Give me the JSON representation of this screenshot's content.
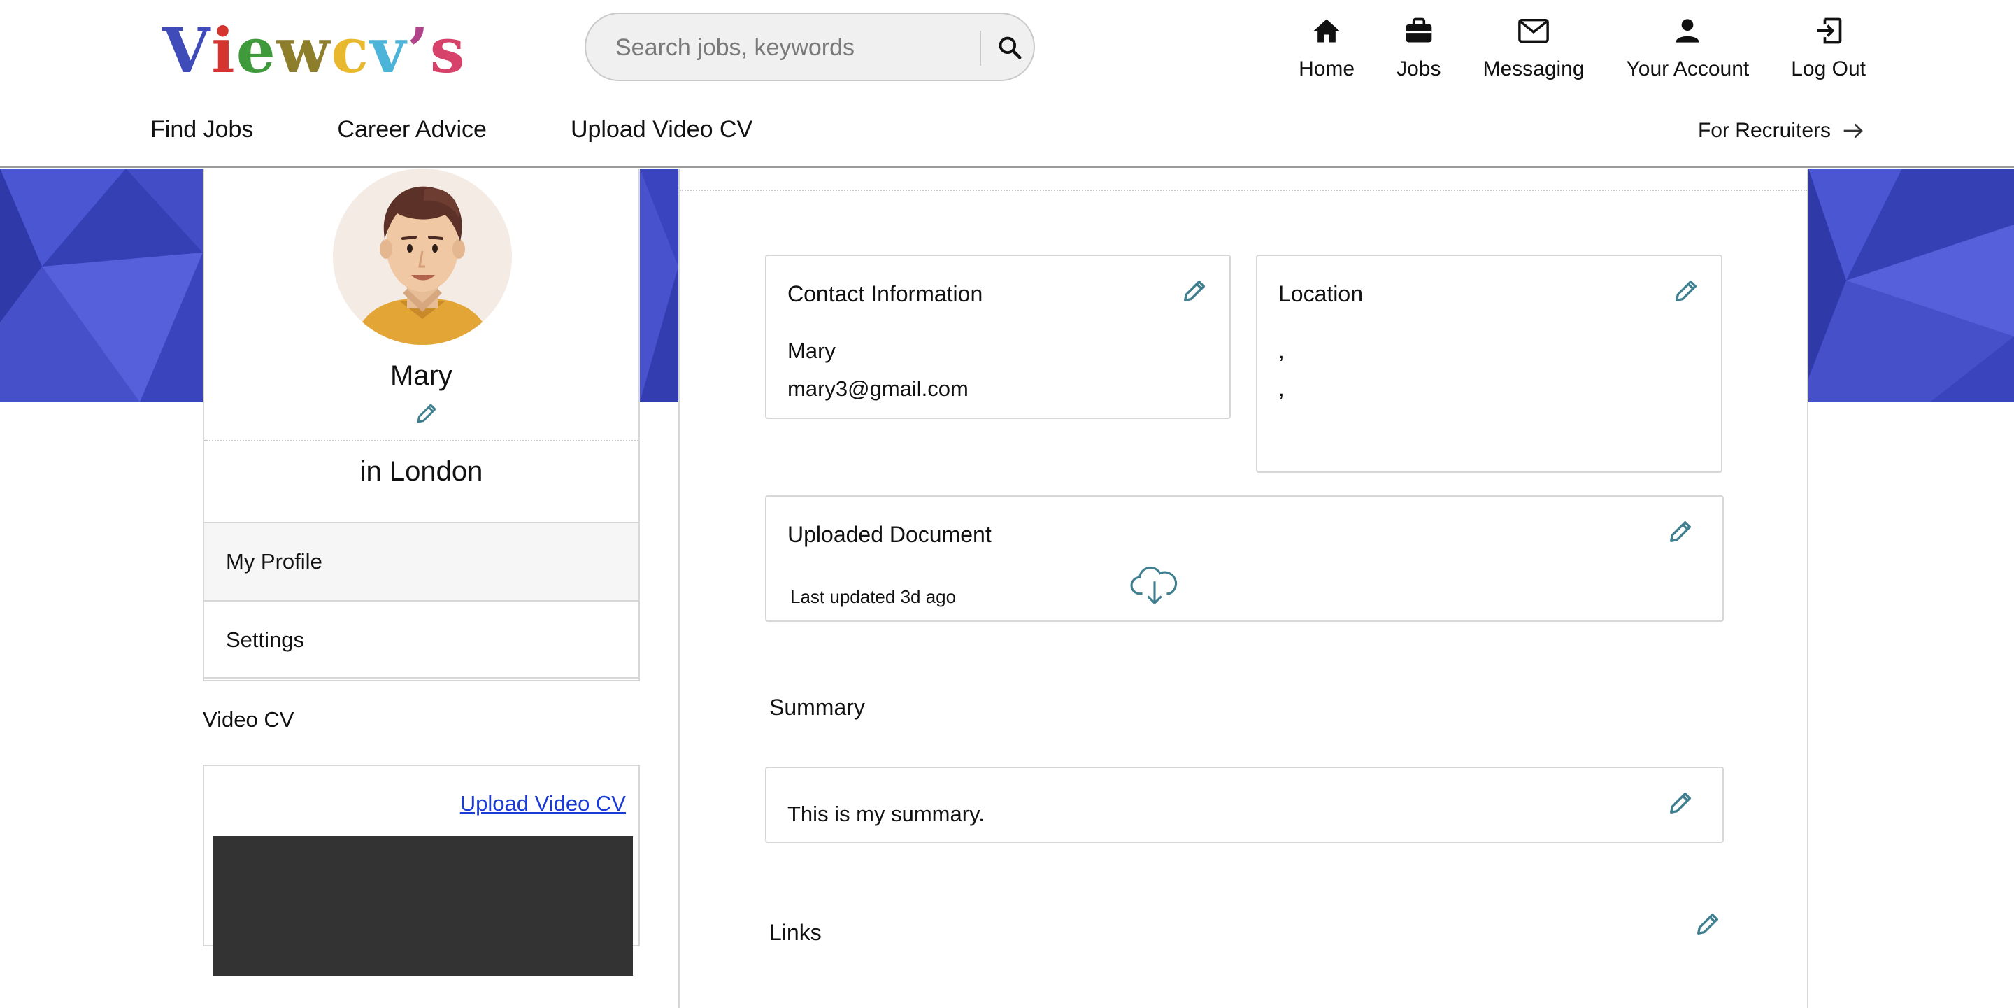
{
  "header": {
    "logo_letters": [
      {
        "ch": "V",
        "color": "#3e4bb8"
      },
      {
        "ch": "i",
        "color": "#d6342f"
      },
      {
        "ch": "e",
        "color": "#3f9a3c"
      },
      {
        "ch": "w",
        "color": "#8c7e2a"
      },
      {
        "ch": "c",
        "color": "#e8b92f"
      },
      {
        "ch": "v",
        "color": "#4cb3d9"
      },
      {
        "ch": "’",
        "color": "#b0438a"
      },
      {
        "ch": "s",
        "color": "#d7426a"
      }
    ],
    "search": {
      "placeholder": "Search jobs, keywords",
      "value": ""
    },
    "nav": [
      {
        "label": "Home",
        "icon": "home-icon"
      },
      {
        "label": "Jobs",
        "icon": "briefcase-icon"
      },
      {
        "label": "Messaging",
        "icon": "envelope-icon"
      },
      {
        "label": "Your Account",
        "icon": "user-icon"
      },
      {
        "label": "Log Out",
        "icon": "logout-icon"
      }
    ],
    "subnav": [
      "Find Jobs",
      "Career Advice",
      "Upload Video CV"
    ],
    "recruiters_label": "For Recruiters"
  },
  "profile": {
    "name": "Mary",
    "location": "in London",
    "menu": [
      {
        "label": "My Profile",
        "active": true
      },
      {
        "label": "Settings",
        "active": false
      }
    ]
  },
  "video_cv": {
    "title": "Video CV",
    "upload_link": "Upload Video CV"
  },
  "contact": {
    "title": "Contact Information",
    "name": "Mary",
    "email": "mary3@gmail.com"
  },
  "location": {
    "title": "Location",
    "line1": ",",
    "line2": ","
  },
  "document": {
    "title": "Uploaded Document",
    "updated": "Last updated 3d ago"
  },
  "summary": {
    "title": "Summary",
    "text": "This is my summary."
  },
  "links": {
    "title": "Links"
  },
  "colors": {
    "accent": "#3f7f8f",
    "banner": "#3a43c0",
    "link": "#1a3bd6"
  }
}
